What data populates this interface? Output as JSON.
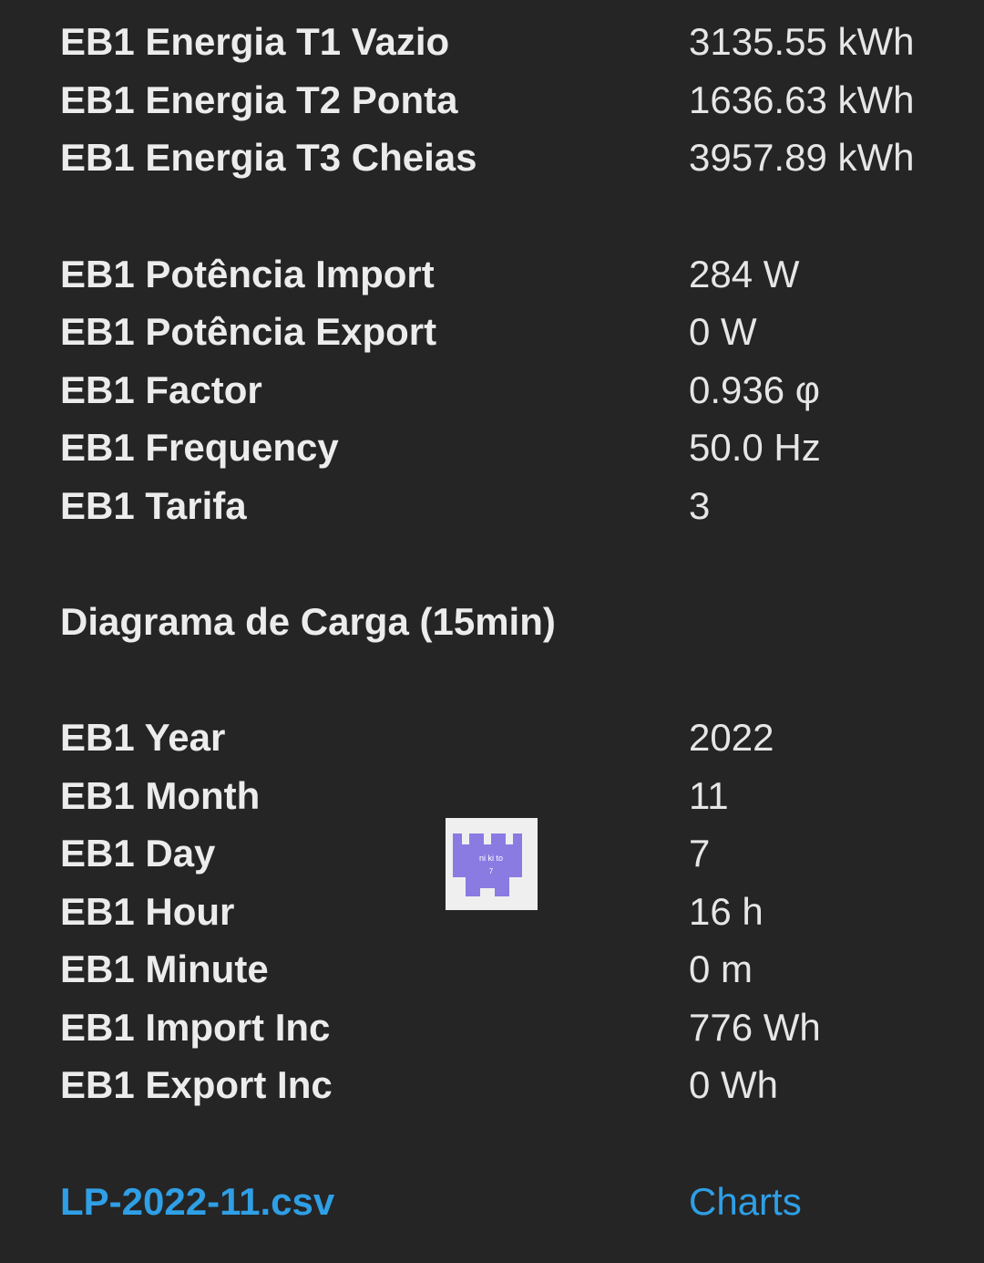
{
  "energy": [
    {
      "label": "EB1 Energia T1 Vazio",
      "value": "3135.55 kWh"
    },
    {
      "label": "EB1 Energia T2 Ponta",
      "value": "1636.63 kWh"
    },
    {
      "label": "EB1 Energia T3 Cheias",
      "value": "3957.89 kWh"
    }
  ],
  "power": [
    {
      "label": "EB1 Potência Import",
      "value": "284 W"
    },
    {
      "label": "EB1 Potência Export",
      "value": "0 W"
    },
    {
      "label": "EB1 Factor",
      "value": "0.936 φ"
    },
    {
      "label": "EB1 Frequency",
      "value": "50.0 Hz"
    },
    {
      "label": "EB1 Tarifa",
      "value": "3"
    }
  ],
  "section_title": "Diagrama de Carga (15min)",
  "load": [
    {
      "label": "EB1 Year",
      "value": "2022"
    },
    {
      "label": "EB1 Month",
      "value": "11"
    },
    {
      "label": "EB1 Day",
      "value": "7"
    },
    {
      "label": "EB1 Hour",
      "value": "16 h"
    },
    {
      "label": "EB1 Minute",
      "value": "0 m"
    },
    {
      "label": "EB1 Import Inc",
      "value": "776 Wh"
    },
    {
      "label": "EB1 Export Inc",
      "value": "0 Wh"
    }
  ],
  "links": {
    "csv": "LP-2022-11.csv",
    "charts": "Charts"
  },
  "watermark": {
    "text": "ni ki to",
    "sub": "7",
    "color": "#8a7be3"
  },
  "colors": {
    "background": "#252525",
    "text": "#ececec",
    "link": "#2f9fe6"
  }
}
